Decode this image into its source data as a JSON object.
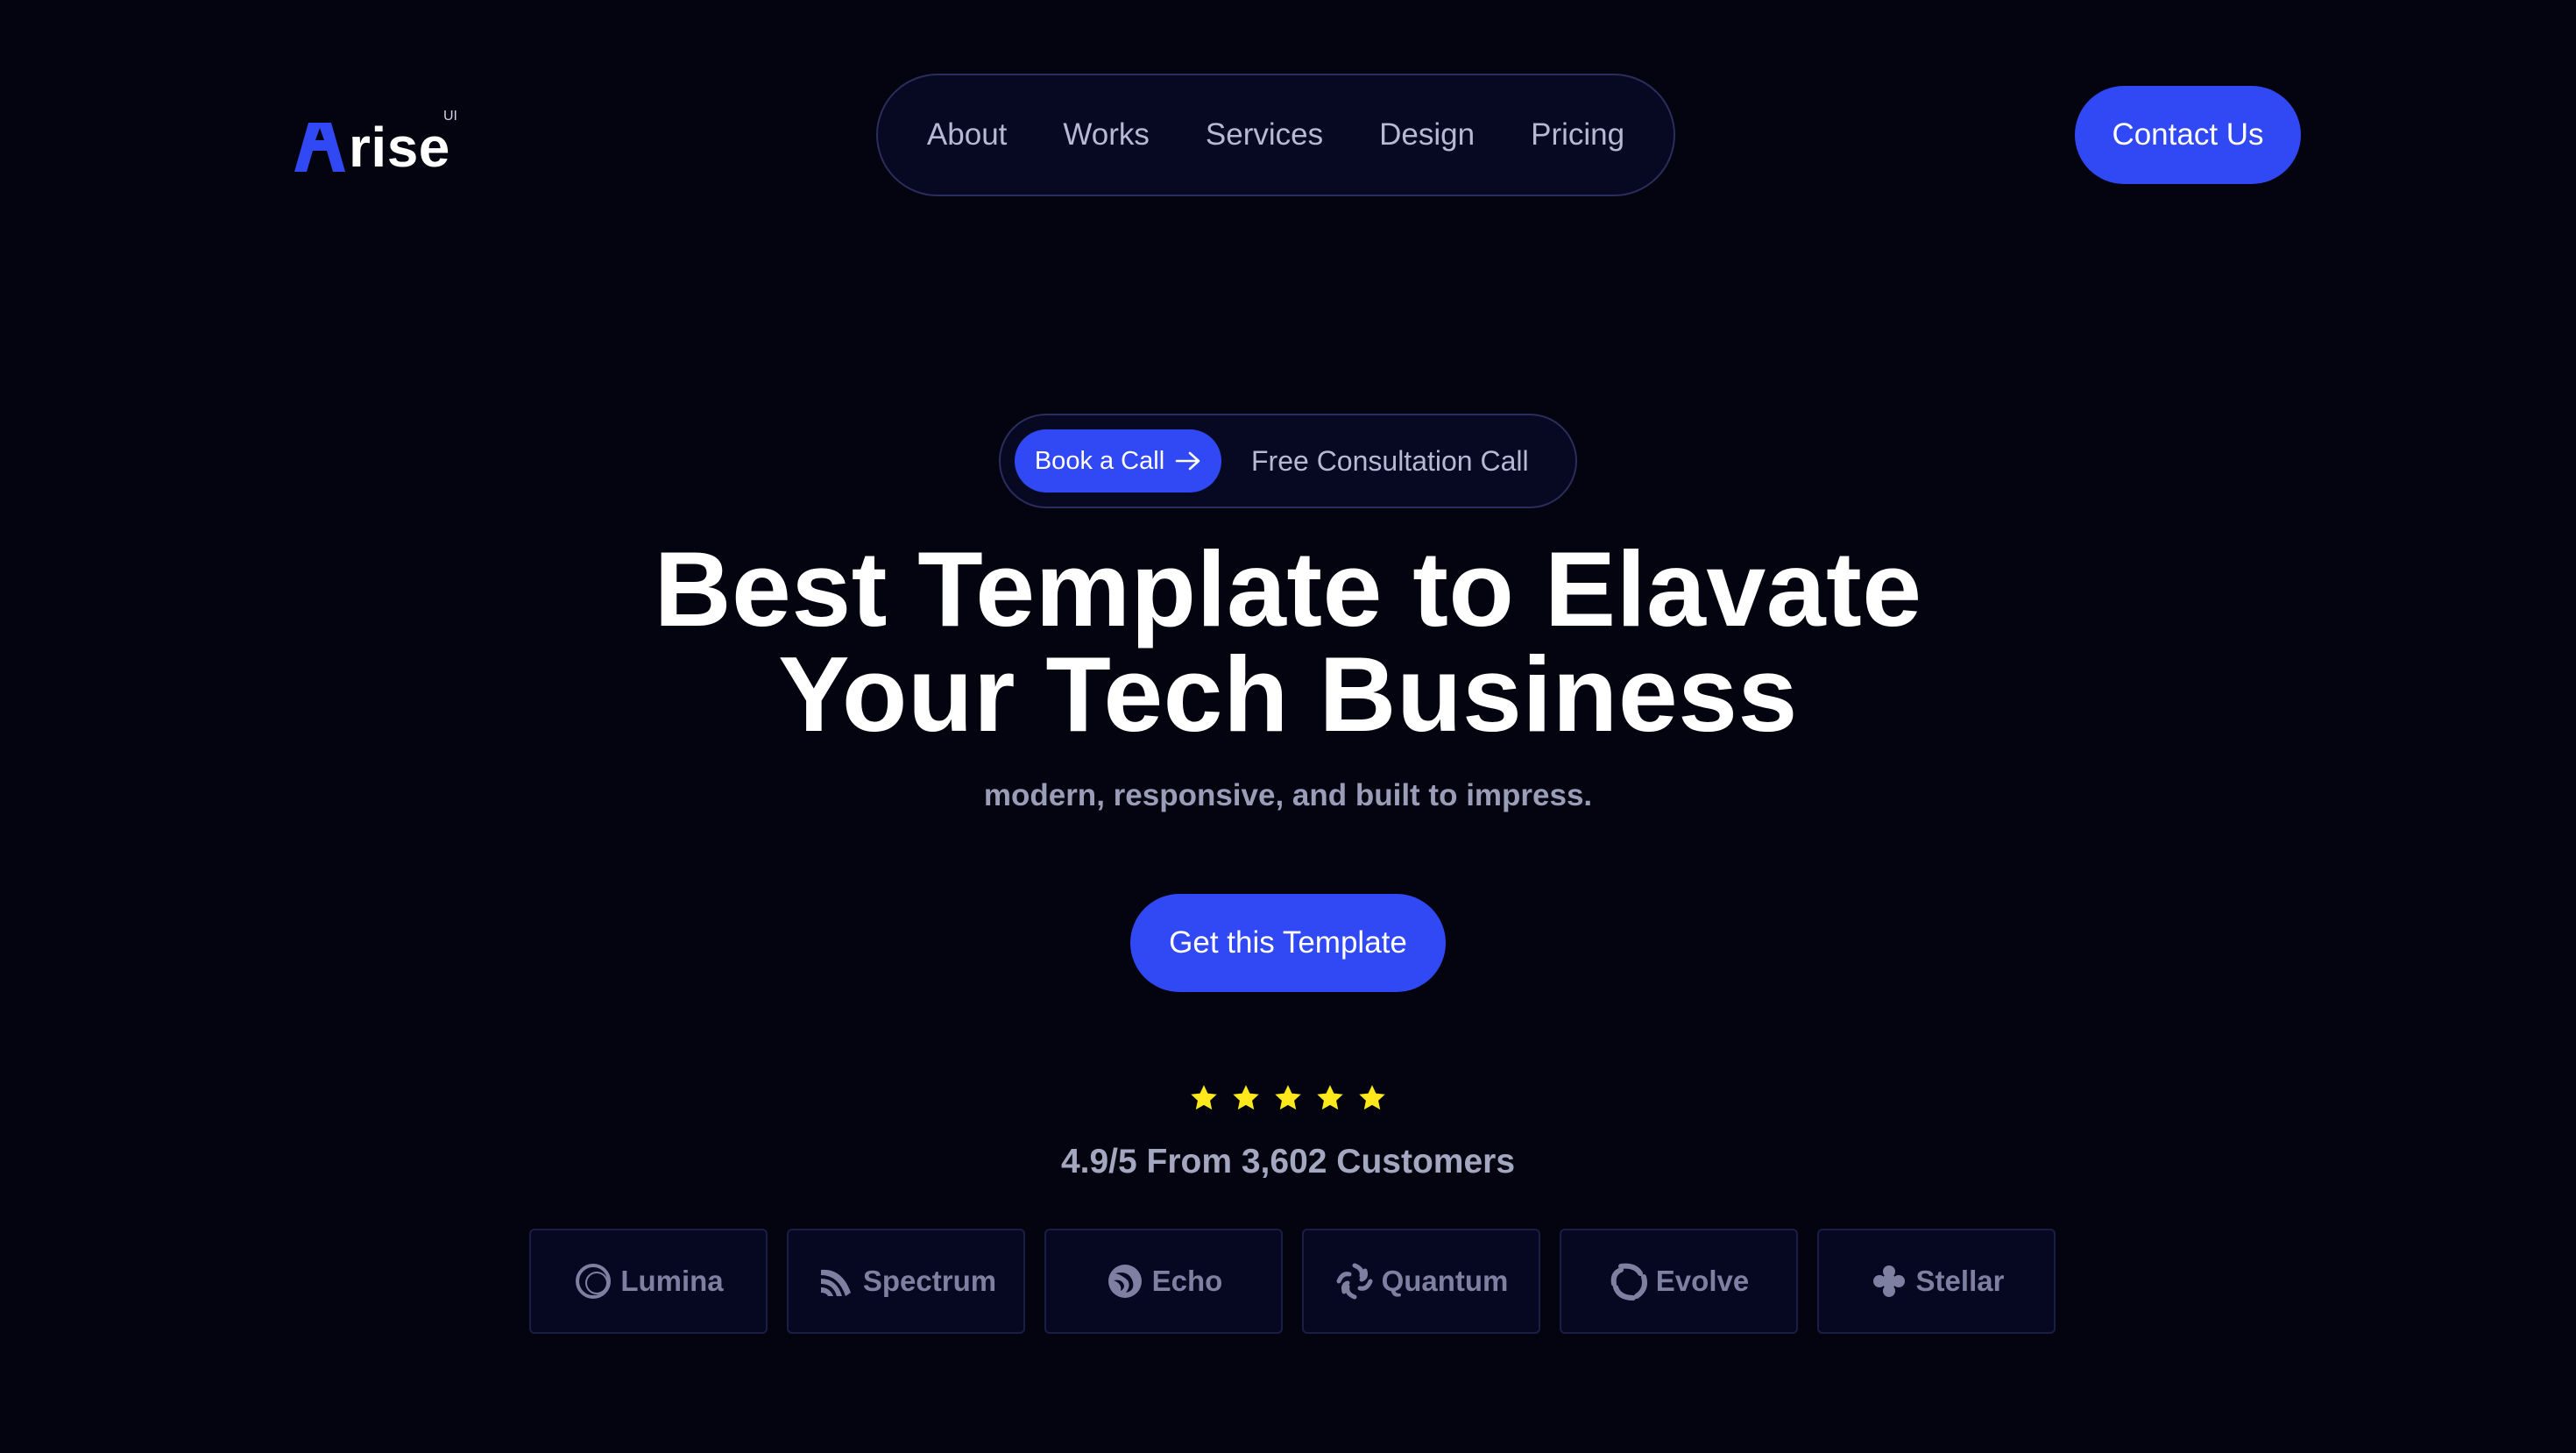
{
  "header": {
    "logo": {
      "word": "rise",
      "superscript": "UI",
      "mark_color": "#3149f4"
    },
    "nav": [
      {
        "label": "About"
      },
      {
        "label": "Works"
      },
      {
        "label": "Services"
      },
      {
        "label": "Design"
      },
      {
        "label": "Pricing"
      }
    ],
    "contact_label": "Contact Us"
  },
  "hero": {
    "pill": {
      "button_label": "Book a Call",
      "button_icon": "arrow-right-icon",
      "text": "Free Consultation Call"
    },
    "headline_line1": "Best Template to Elavate",
    "headline_line2": "Your Tech Business",
    "subheadline": "modern, responsive, and built to impress.",
    "cta_label": "Get this Template",
    "rating": {
      "stars": 5,
      "star_color": "#ffe81c",
      "text": "4.9/5 From 3,602 Customers"
    }
  },
  "brands": [
    {
      "name": "Lumina",
      "icon": "lumina-icon"
    },
    {
      "name": "Spectrum",
      "icon": "spectrum-icon"
    },
    {
      "name": "Echo",
      "icon": "echo-icon"
    },
    {
      "name": "Quantum",
      "icon": "quantum-icon"
    },
    {
      "name": "Evolve",
      "icon": "evolve-icon"
    },
    {
      "name": "Stellar",
      "icon": "stellar-icon"
    }
  ],
  "colors": {
    "background": "#03040f",
    "accent": "#3149f4",
    "muted_text": "#b6b9d4"
  }
}
